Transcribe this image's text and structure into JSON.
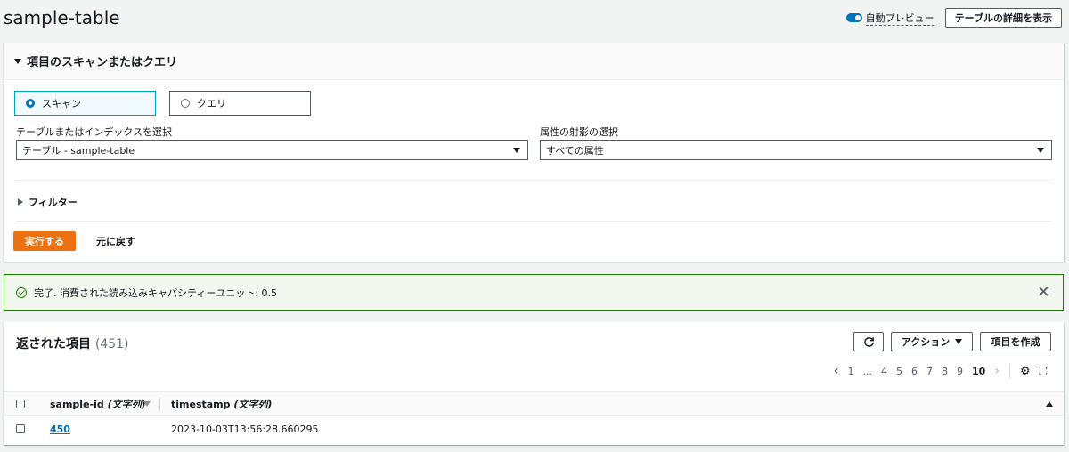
{
  "page": {
    "title": "sample-table"
  },
  "header": {
    "auto_preview_label": "自動プレビュー",
    "details_button": "テーブルの詳細を表示"
  },
  "scan_panel": {
    "title": "項目のスキャンまたはクエリ",
    "mode_scan": "スキャン",
    "mode_query": "クエリ",
    "index_label": "テーブルまたはインデックスを選択",
    "index_value": "テーブル - sample-table",
    "projection_label": "属性の射影の選択",
    "projection_value": "すべての属性",
    "filter_label": "フィルター",
    "run_button": "実行する",
    "reset_button": "元に戻す"
  },
  "flash": {
    "message": "完了. 消費された読み込みキャパシティーユニット: 0.5"
  },
  "items": {
    "title": "返された項目",
    "count": "(451)",
    "actions_button": "アクション",
    "create_button": "項目を作成",
    "pagination": [
      "1",
      "...",
      "4",
      "5",
      "6",
      "7",
      "8",
      "9",
      "10"
    ],
    "current_page": "10",
    "columns": [
      {
        "name": "sample-id",
        "type": "(文字列)"
      },
      {
        "name": "timestamp",
        "type": "(文字列)"
      }
    ],
    "rows": [
      {
        "sample_id": "450",
        "timestamp": "2023-10-03T13:56:28.660295"
      }
    ]
  },
  "colors": {
    "accent": "#0073bb",
    "primary": "#ec7211",
    "success": "#1d8102"
  }
}
